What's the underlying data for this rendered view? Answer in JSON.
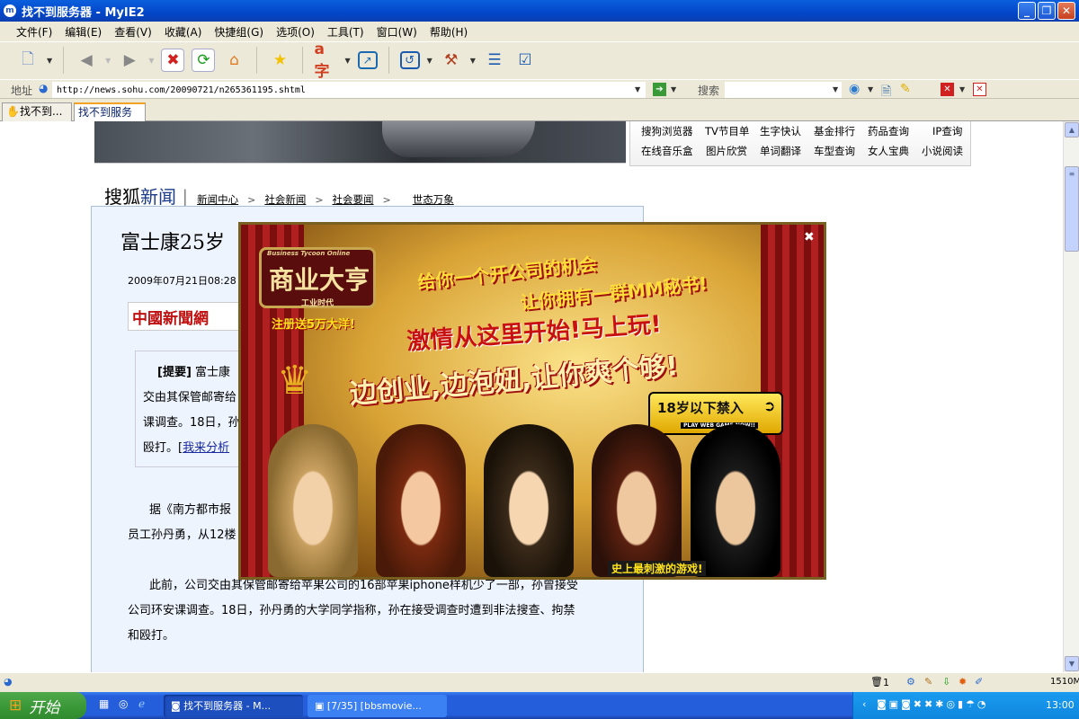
{
  "window": {
    "title": "找不到服务器 - MyIE2",
    "app_icon": "m"
  },
  "menu": [
    "文件(F)",
    "编辑(E)",
    "查看(V)",
    "收藏(A)",
    "快捷组(G)",
    "选项(O)",
    "工具(T)",
    "窗口(W)",
    "帮助(H)"
  ],
  "address": {
    "label": "地址",
    "url": "http://news.sohu.com/20090721/n265361195.shtml",
    "search_label": "搜索",
    "search_value": ""
  },
  "tabs": [
    {
      "label": "找不到..."
    },
    {
      "label": "找不到服务器"
    }
  ],
  "quick_links": [
    [
      "搜狗浏览器",
      "TV节目单",
      "生字快认",
      "基金排行",
      "药品查询",
      "IP查询"
    ],
    [
      "在线音乐盒",
      "图片欣赏",
      "单词翻译",
      "车型查询",
      "女人宝典",
      "小说阅读"
    ]
  ],
  "breadcrumb": {
    "logo_a": "搜狐",
    "logo_b": "新闻",
    "items": [
      "新闻中心",
      "社会新闻",
      "社会要闻",
      "世态万象"
    ],
    "sep": ">"
  },
  "article": {
    "title": "富士康25岁",
    "date": "2009年07月21日08:28",
    "source_logo": "中國新聞網",
    "summary": [
      "[提要] 富士康",
      "交由其保管邮寄给",
      "课调查。18日，孙",
      "殴打。[我来分析"
    ],
    "summary_label": "[提要]",
    "summary_link": "我来分析",
    "p1": [
      "据《南方都市报",
      "员工孙丹勇，从12楼"
    ],
    "p2": [
      "此前，公司交由其保管邮寄给苹果公司的16部苹果iphone样机少了一部，孙曾接受",
      "公司环安课调查。18日，孙丹勇的大学同学指称，孙在接受调查时遭到非法搜查、拘禁",
      "和殴打。"
    ]
  },
  "ad": {
    "game_logo": "商业大亨",
    "game_sub": "工业时代",
    "game_en": "Business Tycoon Online",
    "bonus": "注册送5万大洋!",
    "line1": "给你一个开公司的机会",
    "line2": "让你拥有一群MM秘书!",
    "line3": "激情从这里开始!马上玩!",
    "line4": "边创业,边泡妞,让你爽个够!",
    "age_btn": "18岁以下禁入",
    "age_sub": "PLAY WEB GAME NOW!!",
    "footer": "史上最刺激的游戏!",
    "close": "✖"
  },
  "status": {
    "trash_count": "1",
    "mem": "1510M"
  },
  "taskbar": {
    "start": "开始",
    "tasks": [
      "找不到服务器 - M...",
      "[7/35] [bbsmovie..."
    ],
    "clock": "13:00"
  }
}
